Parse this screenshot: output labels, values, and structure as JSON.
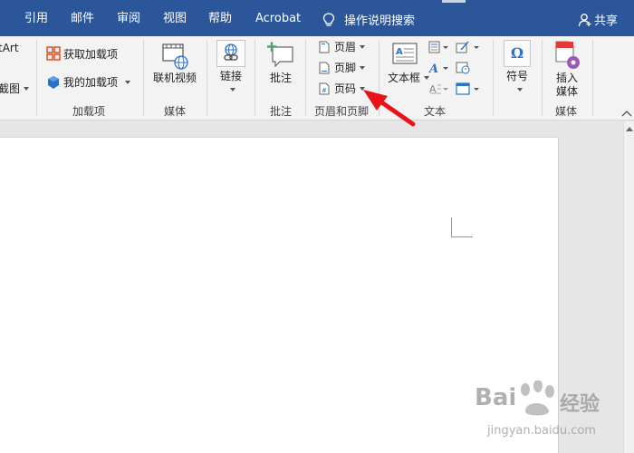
{
  "tabs": [
    {
      "label": "引用"
    },
    {
      "label": "邮件"
    },
    {
      "label": "审阅"
    },
    {
      "label": "视图"
    },
    {
      "label": "帮助"
    },
    {
      "label": "Acrobat"
    }
  ],
  "tell_me": "操作说明搜索",
  "share": "共享",
  "ribbon": {
    "partial_smartart": "tArt",
    "partial_screenshot": "截图",
    "addins": {
      "get_addins": "获取加载项",
      "my_addins": "我的加载项",
      "group_label": "加载项"
    },
    "media": {
      "online_video": "联机视频",
      "group_label": "媒体"
    },
    "links": {
      "link": "链接"
    },
    "comments": {
      "comment": "批注",
      "group_label": "批注"
    },
    "header_footer": {
      "header": "页眉",
      "footer": "页脚",
      "page_number": "页码",
      "group_label": "页眉和页脚"
    },
    "text": {
      "text_box": "文本框",
      "group_label": "文本"
    },
    "symbols": {
      "symbol": "符号"
    },
    "embed_media": {
      "insert_media_line1": "插入",
      "insert_media_line2": "媒体",
      "group_label": "媒体"
    }
  },
  "watermark": {
    "brand": "Bai",
    "brand2": "经验",
    "url": "jingyan.baidu.com"
  },
  "colors": {
    "tabbar": "#2b579a",
    "ribbon": "#f3f3f3",
    "arrow": "#e8121b",
    "accent_blue": "#2b579a"
  }
}
